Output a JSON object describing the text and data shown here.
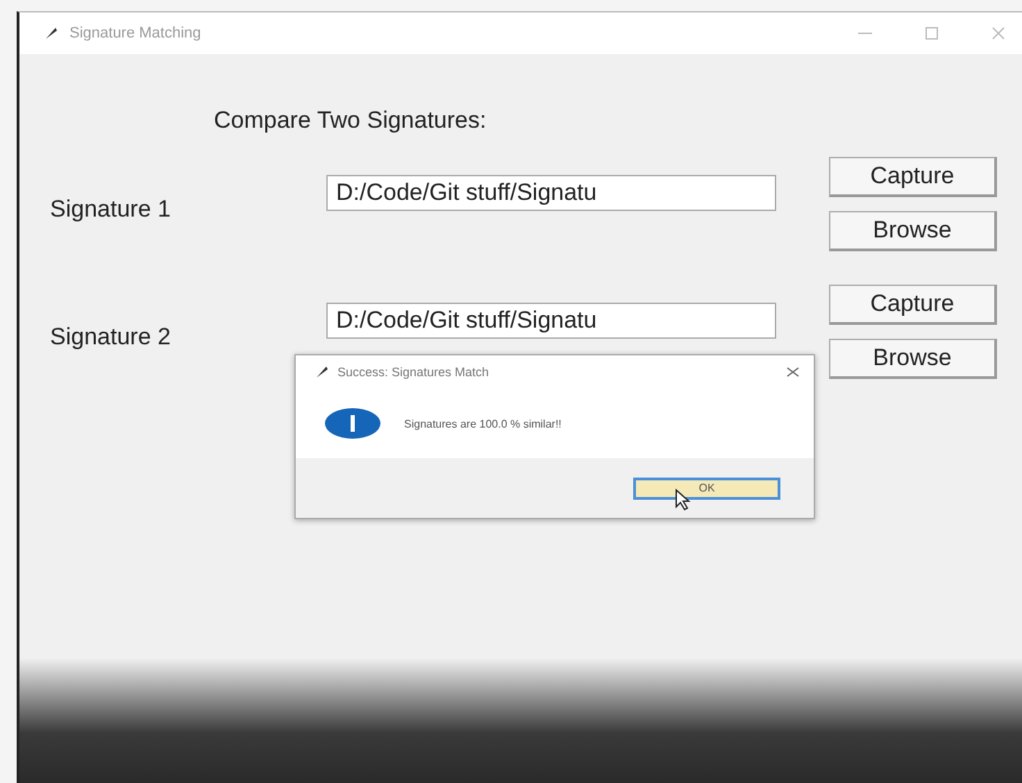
{
  "window": {
    "title": "Signature Matching"
  },
  "heading": "Compare Two Signatures:",
  "rows": [
    {
      "label": "Signature 1",
      "path": "D:/Code/Git stuff/Signatu",
      "buttons": [
        "Capture",
        "Browse"
      ]
    },
    {
      "label": "Signature 2",
      "path": "D:/Code/Git stuff/Signatu",
      "buttons": [
        "Capture",
        "Browse"
      ]
    }
  ],
  "dialog": {
    "title": "Success: Signatures Match",
    "message": "Signatures are 100.0 % similar!!",
    "button": "OK"
  }
}
